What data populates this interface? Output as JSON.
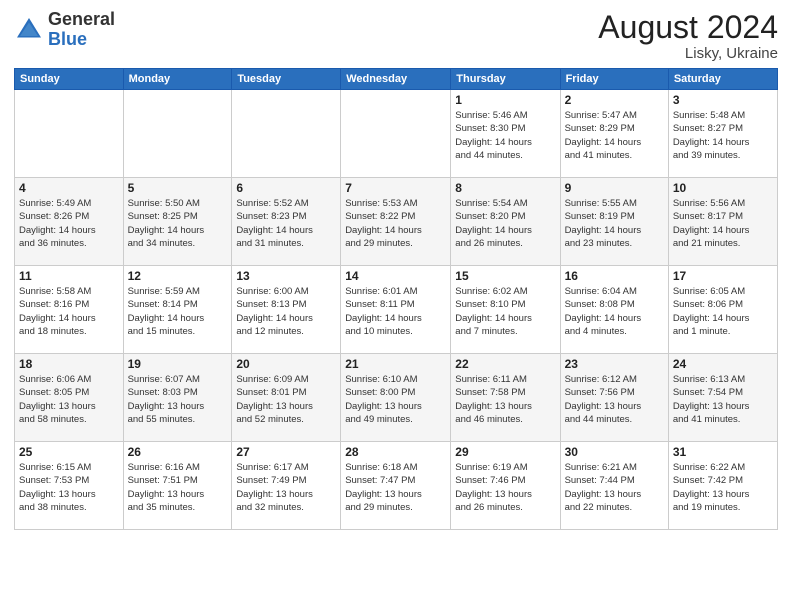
{
  "logo": {
    "general": "General",
    "blue": "Blue"
  },
  "header": {
    "month_year": "August 2024",
    "location": "Lisky, Ukraine"
  },
  "days_of_week": [
    "Sunday",
    "Monday",
    "Tuesday",
    "Wednesday",
    "Thursday",
    "Friday",
    "Saturday"
  ],
  "weeks": [
    [
      {
        "day": "",
        "info": ""
      },
      {
        "day": "",
        "info": ""
      },
      {
        "day": "",
        "info": ""
      },
      {
        "day": "",
        "info": ""
      },
      {
        "day": "1",
        "info": "Sunrise: 5:46 AM\nSunset: 8:30 PM\nDaylight: 14 hours\nand 44 minutes."
      },
      {
        "day": "2",
        "info": "Sunrise: 5:47 AM\nSunset: 8:29 PM\nDaylight: 14 hours\nand 41 minutes."
      },
      {
        "day": "3",
        "info": "Sunrise: 5:48 AM\nSunset: 8:27 PM\nDaylight: 14 hours\nand 39 minutes."
      }
    ],
    [
      {
        "day": "4",
        "info": "Sunrise: 5:49 AM\nSunset: 8:26 PM\nDaylight: 14 hours\nand 36 minutes."
      },
      {
        "day": "5",
        "info": "Sunrise: 5:50 AM\nSunset: 8:25 PM\nDaylight: 14 hours\nand 34 minutes."
      },
      {
        "day": "6",
        "info": "Sunrise: 5:52 AM\nSunset: 8:23 PM\nDaylight: 14 hours\nand 31 minutes."
      },
      {
        "day": "7",
        "info": "Sunrise: 5:53 AM\nSunset: 8:22 PM\nDaylight: 14 hours\nand 29 minutes."
      },
      {
        "day": "8",
        "info": "Sunrise: 5:54 AM\nSunset: 8:20 PM\nDaylight: 14 hours\nand 26 minutes."
      },
      {
        "day": "9",
        "info": "Sunrise: 5:55 AM\nSunset: 8:19 PM\nDaylight: 14 hours\nand 23 minutes."
      },
      {
        "day": "10",
        "info": "Sunrise: 5:56 AM\nSunset: 8:17 PM\nDaylight: 14 hours\nand 21 minutes."
      }
    ],
    [
      {
        "day": "11",
        "info": "Sunrise: 5:58 AM\nSunset: 8:16 PM\nDaylight: 14 hours\nand 18 minutes."
      },
      {
        "day": "12",
        "info": "Sunrise: 5:59 AM\nSunset: 8:14 PM\nDaylight: 14 hours\nand 15 minutes."
      },
      {
        "day": "13",
        "info": "Sunrise: 6:00 AM\nSunset: 8:13 PM\nDaylight: 14 hours\nand 12 minutes."
      },
      {
        "day": "14",
        "info": "Sunrise: 6:01 AM\nSunset: 8:11 PM\nDaylight: 14 hours\nand 10 minutes."
      },
      {
        "day": "15",
        "info": "Sunrise: 6:02 AM\nSunset: 8:10 PM\nDaylight: 14 hours\nand 7 minutes."
      },
      {
        "day": "16",
        "info": "Sunrise: 6:04 AM\nSunset: 8:08 PM\nDaylight: 14 hours\nand 4 minutes."
      },
      {
        "day": "17",
        "info": "Sunrise: 6:05 AM\nSunset: 8:06 PM\nDaylight: 14 hours\nand 1 minute."
      }
    ],
    [
      {
        "day": "18",
        "info": "Sunrise: 6:06 AM\nSunset: 8:05 PM\nDaylight: 13 hours\nand 58 minutes."
      },
      {
        "day": "19",
        "info": "Sunrise: 6:07 AM\nSunset: 8:03 PM\nDaylight: 13 hours\nand 55 minutes."
      },
      {
        "day": "20",
        "info": "Sunrise: 6:09 AM\nSunset: 8:01 PM\nDaylight: 13 hours\nand 52 minutes."
      },
      {
        "day": "21",
        "info": "Sunrise: 6:10 AM\nSunset: 8:00 PM\nDaylight: 13 hours\nand 49 minutes."
      },
      {
        "day": "22",
        "info": "Sunrise: 6:11 AM\nSunset: 7:58 PM\nDaylight: 13 hours\nand 46 minutes."
      },
      {
        "day": "23",
        "info": "Sunrise: 6:12 AM\nSunset: 7:56 PM\nDaylight: 13 hours\nand 44 minutes."
      },
      {
        "day": "24",
        "info": "Sunrise: 6:13 AM\nSunset: 7:54 PM\nDaylight: 13 hours\nand 41 minutes."
      }
    ],
    [
      {
        "day": "25",
        "info": "Sunrise: 6:15 AM\nSunset: 7:53 PM\nDaylight: 13 hours\nand 38 minutes."
      },
      {
        "day": "26",
        "info": "Sunrise: 6:16 AM\nSunset: 7:51 PM\nDaylight: 13 hours\nand 35 minutes."
      },
      {
        "day": "27",
        "info": "Sunrise: 6:17 AM\nSunset: 7:49 PM\nDaylight: 13 hours\nand 32 minutes."
      },
      {
        "day": "28",
        "info": "Sunrise: 6:18 AM\nSunset: 7:47 PM\nDaylight: 13 hours\nand 29 minutes."
      },
      {
        "day": "29",
        "info": "Sunrise: 6:19 AM\nSunset: 7:46 PM\nDaylight: 13 hours\nand 26 minutes."
      },
      {
        "day": "30",
        "info": "Sunrise: 6:21 AM\nSunset: 7:44 PM\nDaylight: 13 hours\nand 22 minutes."
      },
      {
        "day": "31",
        "info": "Sunrise: 6:22 AM\nSunset: 7:42 PM\nDaylight: 13 hours\nand 19 minutes."
      }
    ]
  ]
}
